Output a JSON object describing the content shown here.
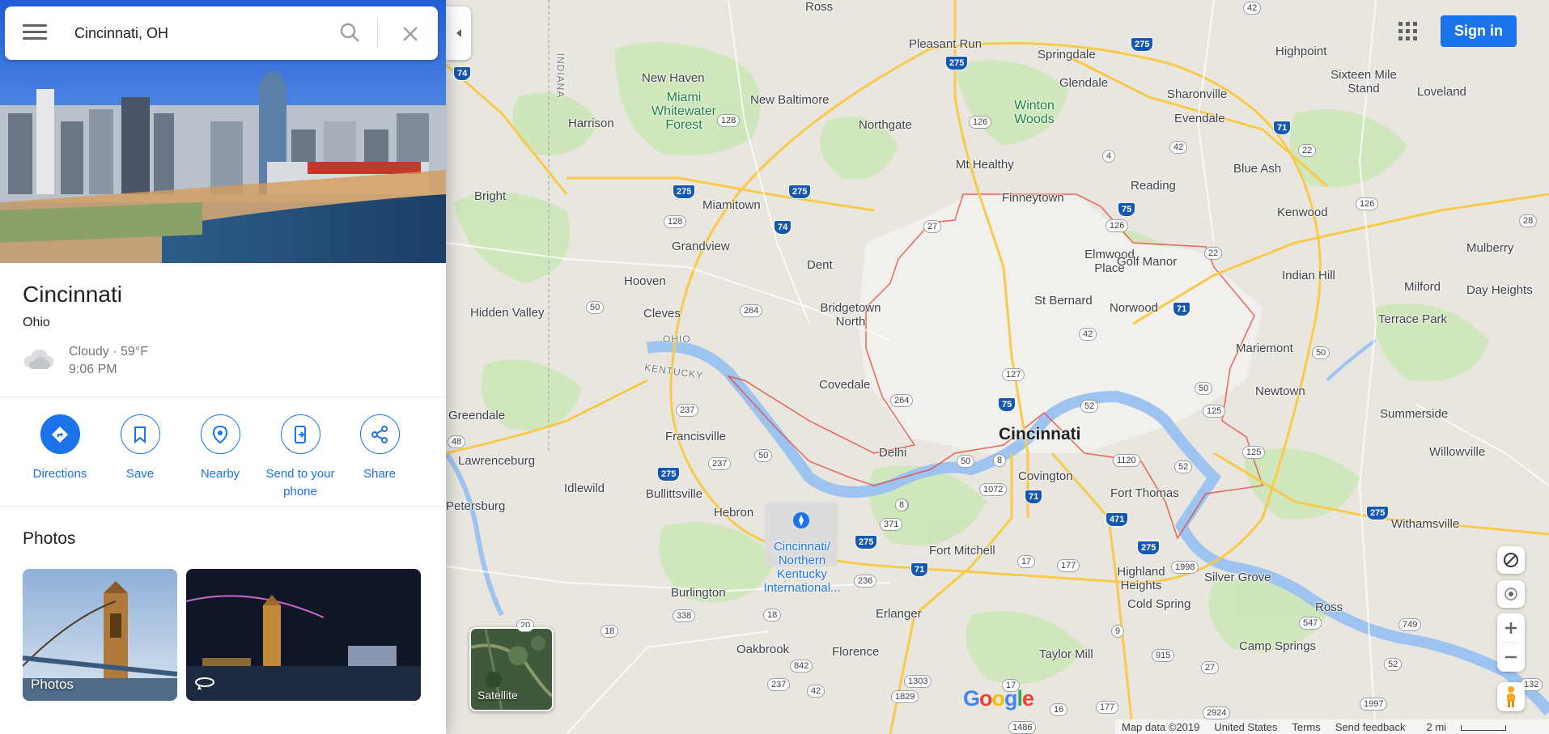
{
  "search": {
    "value": "Cincinnati, OH"
  },
  "place": {
    "title": "Cincinnati",
    "subtitle": "Ohio",
    "weather_condition": "Cloudy · 59°F",
    "weather_time": "9:06 PM"
  },
  "actions": [
    {
      "label": "Directions",
      "icon": "directions-icon"
    },
    {
      "label": "Save",
      "icon": "bookmark-icon"
    },
    {
      "label": "Nearby",
      "icon": "nearby-icon"
    },
    {
      "label": "Send to your phone",
      "icon": "send-to-phone-icon"
    },
    {
      "label": "Share",
      "icon": "share-icon"
    }
  ],
  "photos": {
    "title": "Photos",
    "items": [
      {
        "caption": "Photos"
      },
      {
        "caption": ""
      }
    ]
  },
  "header": {
    "signin_label": "Sign in"
  },
  "map": {
    "layer_toggle_label": "Satellite",
    "logo": "Google",
    "places": [
      {
        "name": "Ross",
        "kind": "town"
      },
      {
        "name": "Pleasant Run",
        "kind": "town"
      },
      {
        "name": "Springdale",
        "kind": "town"
      },
      {
        "name": "Highpoint",
        "kind": "town"
      },
      {
        "name": "Sixteen Mile Stand",
        "kind": "town"
      },
      {
        "name": "Loveland",
        "kind": "town"
      },
      {
        "name": "New Haven",
        "kind": "town"
      },
      {
        "name": "New Baltimore",
        "kind": "town"
      },
      {
        "name": "Glendale",
        "kind": "town"
      },
      {
        "name": "Sharonville",
        "kind": "town"
      },
      {
        "name": "Evendale",
        "kind": "town"
      },
      {
        "name": "Harrison",
        "kind": "town"
      },
      {
        "name": "Northgate",
        "kind": "town"
      },
      {
        "name": "Mt Healthy",
        "kind": "town"
      },
      {
        "name": "Reading",
        "kind": "town"
      },
      {
        "name": "Blue Ash",
        "kind": "town"
      },
      {
        "name": "Bright",
        "kind": "town"
      },
      {
        "name": "Miamitown",
        "kind": "town"
      },
      {
        "name": "Finneytown",
        "kind": "town"
      },
      {
        "name": "Kenwood",
        "kind": "town"
      },
      {
        "name": "Mulberry",
        "kind": "town"
      },
      {
        "name": "Grandview",
        "kind": "town"
      },
      {
        "name": "Elmwood Place",
        "kind": "town"
      },
      {
        "name": "Golf Manor",
        "kind": "town"
      },
      {
        "name": "Dent",
        "kind": "town"
      },
      {
        "name": "Indian Hill",
        "kind": "town"
      },
      {
        "name": "Hooven",
        "kind": "town"
      },
      {
        "name": "Milford",
        "kind": "town"
      },
      {
        "name": "Day Heights",
        "kind": "town"
      },
      {
        "name": "Bridgetown North",
        "kind": "town"
      },
      {
        "name": "St Bernard",
        "kind": "town"
      },
      {
        "name": "Norwood",
        "kind": "town"
      },
      {
        "name": "Hidden Valley",
        "kind": "town"
      },
      {
        "name": "Cleves",
        "kind": "town"
      },
      {
        "name": "Terrace Park",
        "kind": "town"
      },
      {
        "name": "Mariemont",
        "kind": "town"
      },
      {
        "name": "Covedale",
        "kind": "town"
      },
      {
        "name": "Newtown",
        "kind": "town"
      },
      {
        "name": "Greendale",
        "kind": "town"
      },
      {
        "name": "Summerside",
        "kind": "town"
      },
      {
        "name": "Francisville",
        "kind": "town"
      },
      {
        "name": "Cincinnati",
        "kind": "city"
      },
      {
        "name": "Delhi",
        "kind": "town"
      },
      {
        "name": "Willowville",
        "kind": "town"
      },
      {
        "name": "Lawrenceburg",
        "kind": "town"
      },
      {
        "name": "Covington",
        "kind": "town"
      },
      {
        "name": "Idlewild",
        "kind": "town"
      },
      {
        "name": "Fort Thomas",
        "kind": "town"
      },
      {
        "name": "Bullittsville",
        "kind": "town"
      },
      {
        "name": "Petersburg",
        "kind": "town"
      },
      {
        "name": "Hebron",
        "kind": "town"
      },
      {
        "name": "Withamsville",
        "kind": "town"
      },
      {
        "name": "Fort Mitchell",
        "kind": "town"
      },
      {
        "name": "Highland Heights",
        "kind": "town"
      },
      {
        "name": "Silver Grove",
        "kind": "town"
      },
      {
        "name": "Cold Spring",
        "kind": "town"
      },
      {
        "name": "Burlington",
        "kind": "town"
      },
      {
        "name": "Ross",
        "kind": "town"
      },
      {
        "name": "Erlanger",
        "kind": "town"
      },
      {
        "name": "Camp Springs",
        "kind": "town"
      },
      {
        "name": "Oakbrook",
        "kind": "town"
      },
      {
        "name": "Florence",
        "kind": "town"
      },
      {
        "name": "Taylor Mill",
        "kind": "town"
      },
      {
        "name": "Miami Whitewater Forest",
        "kind": "park"
      },
      {
        "name": "Winton Woods",
        "kind": "park"
      },
      {
        "name": "Cincinnati/ Northern Kentucky International...",
        "kind": "airport"
      },
      {
        "name": "OHIO",
        "kind": "state"
      },
      {
        "name": "INDIANA",
        "kind": "state"
      },
      {
        "name": "KENTUCKY",
        "kind": "state"
      }
    ],
    "routes": [
      "42",
      "275",
      "275",
      "74",
      "128",
      "126",
      "4",
      "42",
      "71",
      "22",
      "275",
      "275",
      "74",
      "75",
      "126",
      "27",
      "22",
      "126",
      "28",
      "128",
      "50",
      "264",
      "71",
      "42",
      "50",
      "127",
      "75",
      "50",
      "125",
      "50",
      "264",
      "237",
      "52",
      "8",
      "50",
      "8",
      "237",
      "1072",
      "71",
      "1120",
      "125",
      "52",
      "275",
      "275",
      "8",
      "371",
      "275",
      "471",
      "48",
      "275",
      "17",
      "177",
      "1998",
      "236",
      "20",
      "18",
      "338",
      "71",
      "9",
      "547",
      "749",
      "18",
      "915",
      "842",
      "237",
      "42",
      "1303",
      "1829",
      "17",
      "27",
      "16",
      "177",
      "2924",
      "1997",
      "52",
      "132",
      "1486"
    ]
  },
  "footer": {
    "map_data": "Map data ©2019",
    "region": "United States",
    "terms": "Terms",
    "feedback": "Send feedback",
    "scale": "2 mi"
  },
  "colors": {
    "accent": "#1a73e8",
    "city_boundary": "#ea4335",
    "highway": "#f9c94a",
    "water": "#9dc3f0",
    "park": "#c6e5b3"
  }
}
